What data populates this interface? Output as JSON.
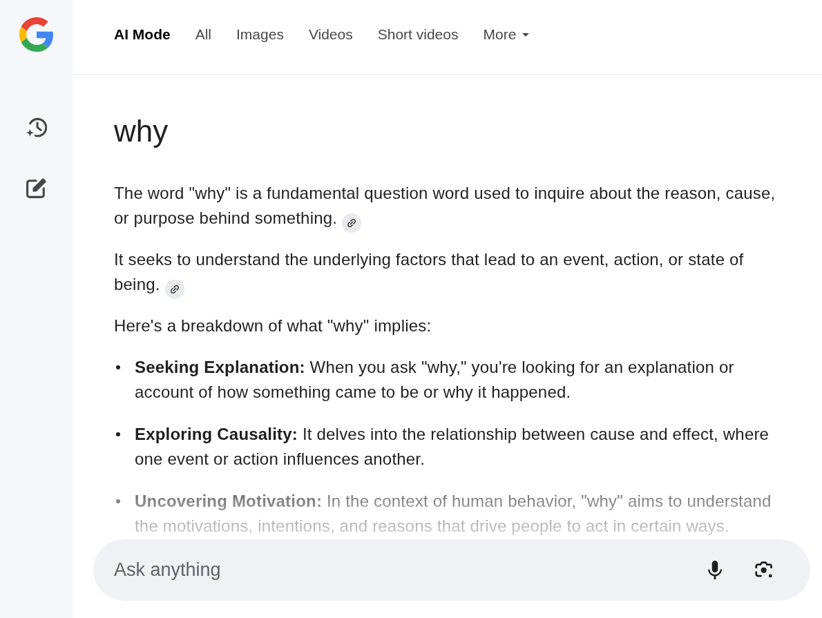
{
  "tabs": [
    {
      "label": "AI Mode",
      "selected": true,
      "kind": "link"
    },
    {
      "label": "All",
      "selected": false,
      "kind": "link"
    },
    {
      "label": "Images",
      "selected": false,
      "kind": "link"
    },
    {
      "label": "Videos",
      "selected": false,
      "kind": "link"
    },
    {
      "label": "Short videos",
      "selected": false,
      "kind": "link"
    },
    {
      "label": "More",
      "selected": false,
      "kind": "menu"
    }
  ],
  "query": "why",
  "answer": {
    "paragraphs": [
      {
        "text": "The word \"why\" is a fundamental question word used to inquire about the reason, cause, or purpose behind something.",
        "source_link": true
      },
      {
        "text": "It seeks to understand the underlying factors that lead to an event, action, or state of being.",
        "source_link": true
      },
      {
        "text": "Here's a breakdown of what \"why\" implies:",
        "source_link": false
      }
    ],
    "bullets": [
      {
        "text": "**Seeking Explanation:** When you ask \"why,\" you're looking for an explanation or account of how something came to be or why it happened."
      },
      {
        "text": "**Exploring Causality:** It delves into the relationship between cause and effect, where one event or action influences another."
      },
      {
        "text": "**Uncovering Motivation:** In the context of human behavior, \"why\" aims to understand the motivations, intentions, and reasons that drive people to act in certain ways."
      }
    ]
  },
  "search": {
    "placeholder": "Ask anything"
  }
}
